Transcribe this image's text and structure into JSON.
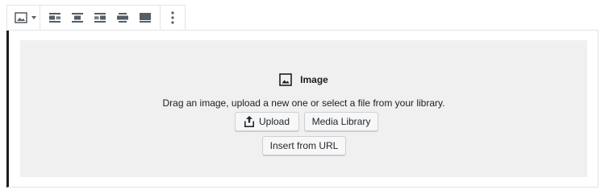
{
  "toolbar": {
    "block_switcher_icon": "image-icon",
    "align_icons": [
      "align-left-icon",
      "align-center-icon",
      "align-right-icon",
      "align-wide-icon",
      "align-full-icon"
    ],
    "more_icon": "more-vertical-icon"
  },
  "placeholder": {
    "title": "Image",
    "instructions": "Drag an image, upload a new one or select a file from your library.",
    "upload_label": "Upload",
    "media_library_label": "Media Library",
    "insert_url_label": "Insert from URL"
  },
  "colors": {
    "placeholder_bg": "#f0f0f0",
    "block_border_left": "#1e1e1e",
    "button_bg": "#f7f7f7",
    "toolbar_icon": "#555d66"
  }
}
